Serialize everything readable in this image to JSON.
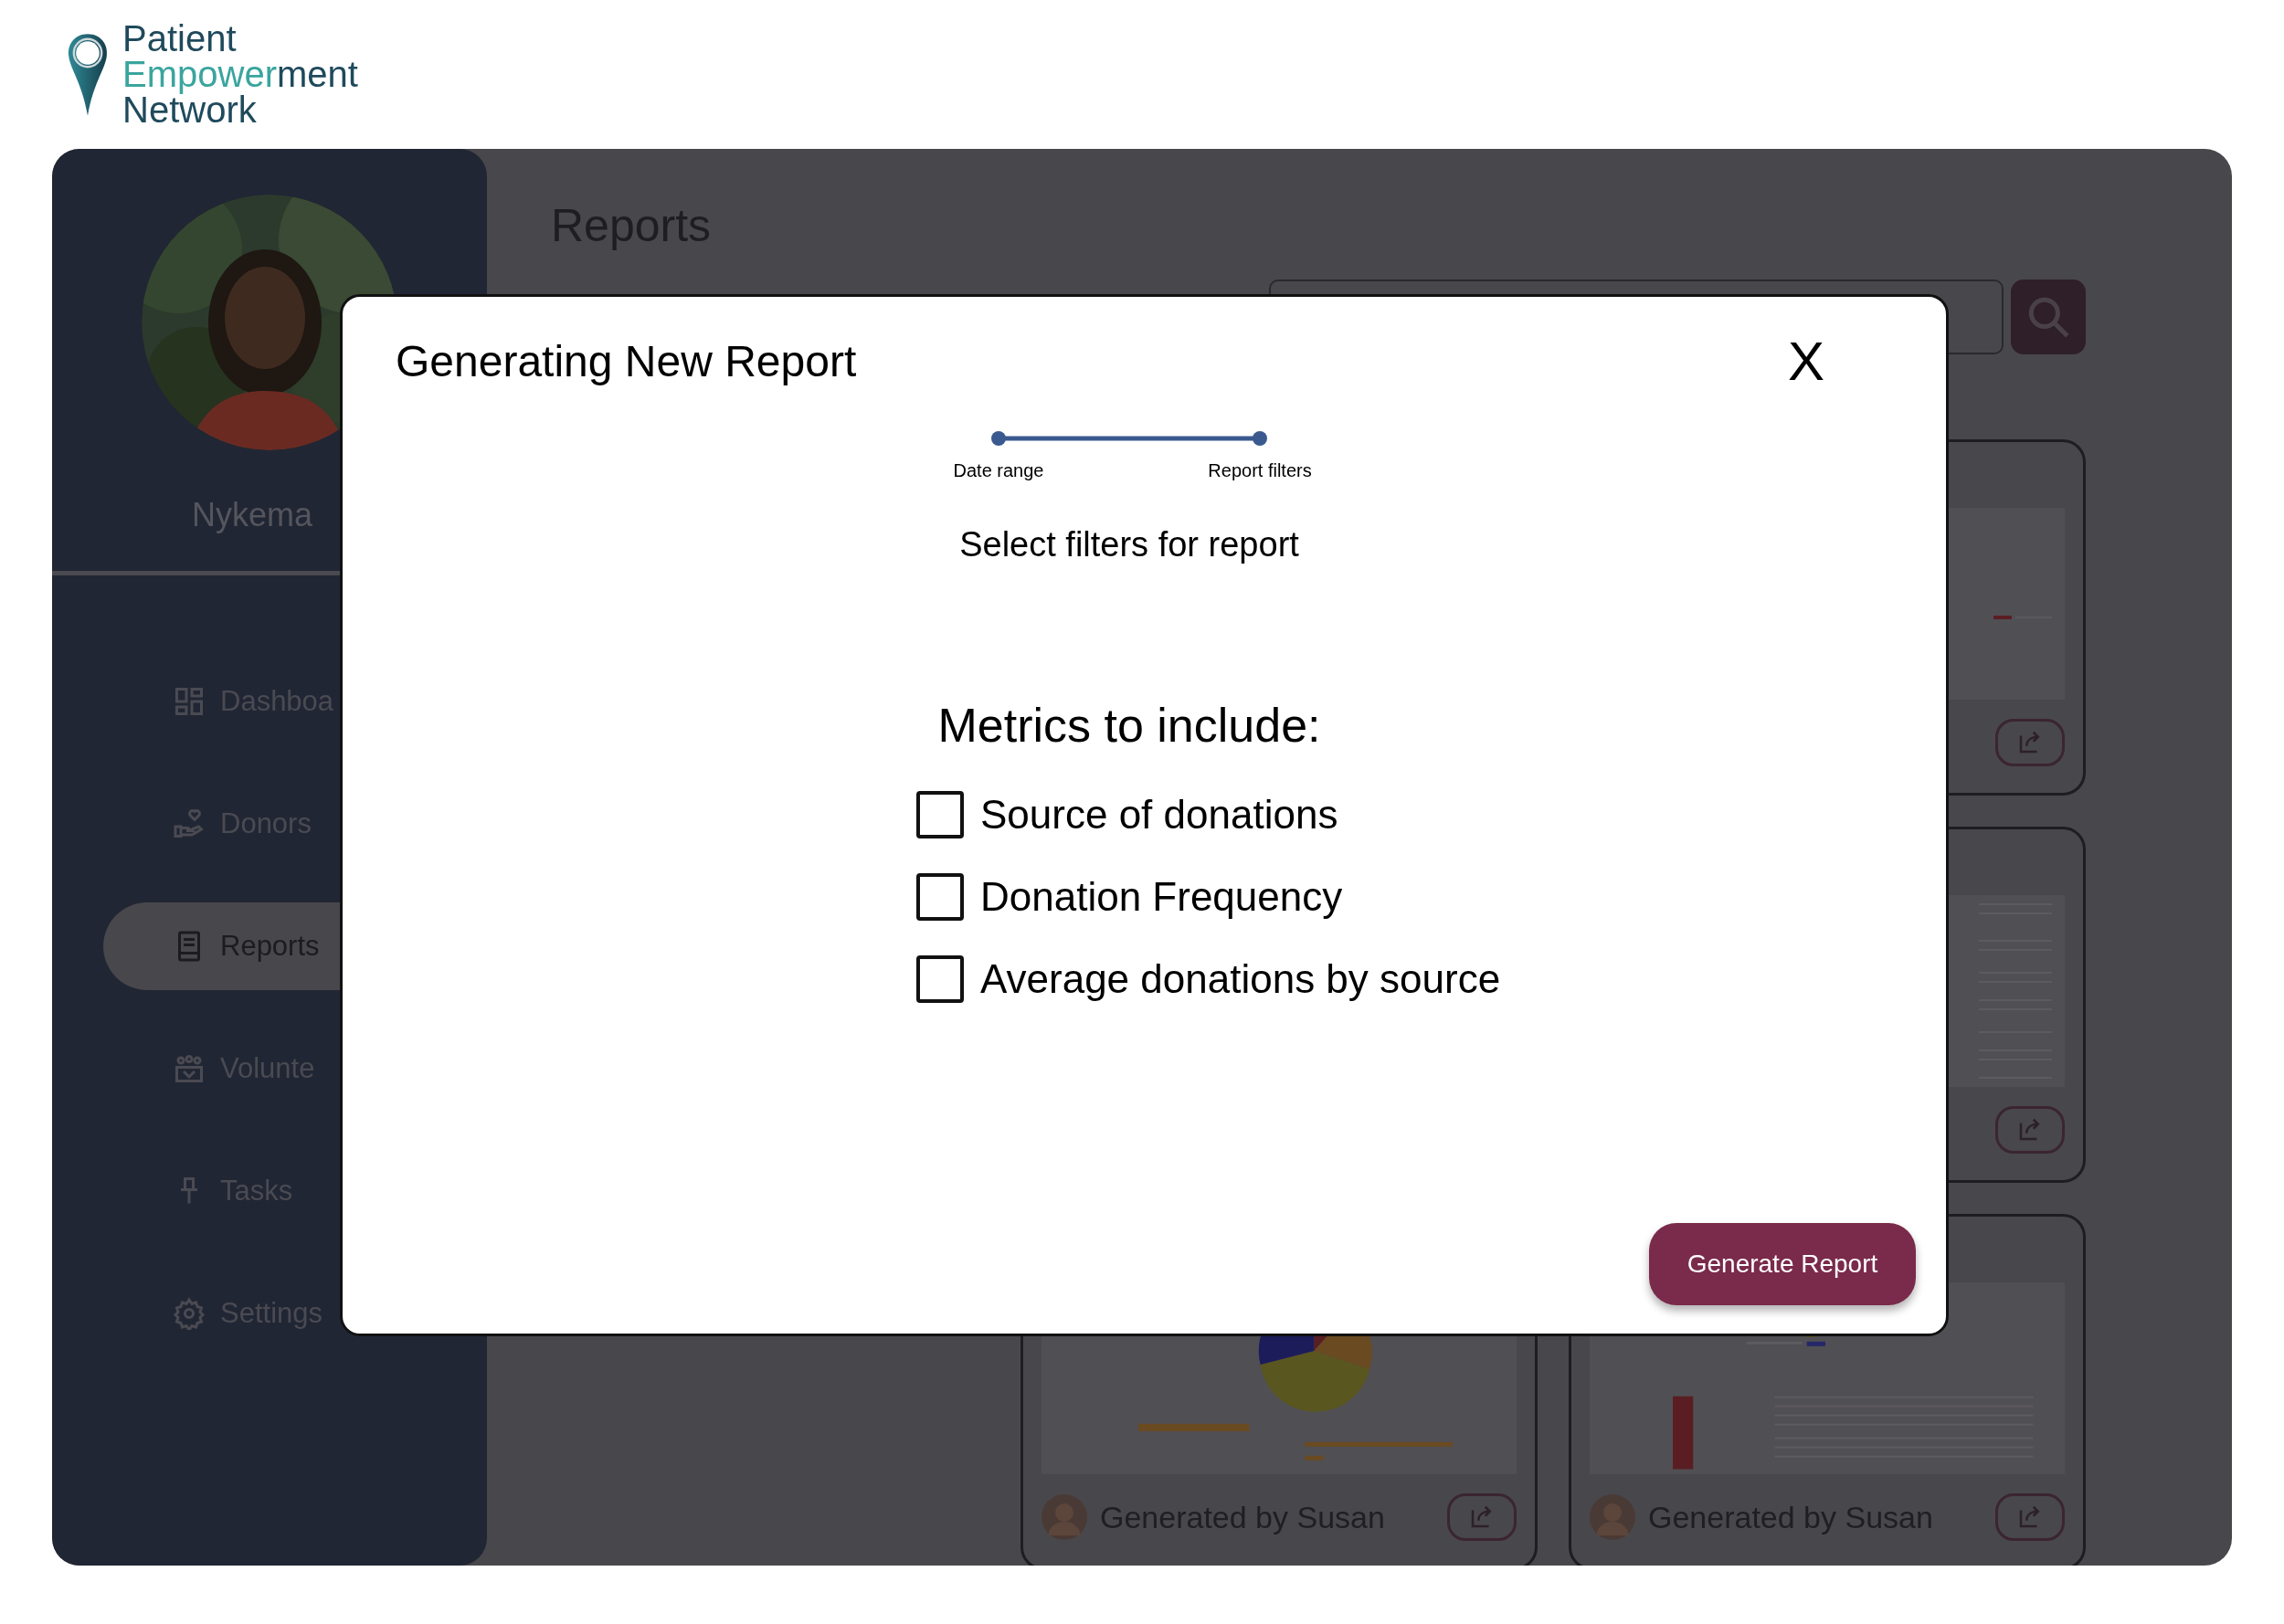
{
  "logo": {
    "lines": [
      [
        {
          "text": "Patient",
          "accent": false
        }
      ],
      [
        {
          "text": "Empower",
          "accent": true
        },
        {
          "text": "ment",
          "accent": false
        }
      ],
      [
        {
          "text": "Network",
          "accent": false
        }
      ]
    ]
  },
  "sidebar": {
    "user_name": "Nykema",
    "items": [
      {
        "kind": "dashboard",
        "label": "Dashboa",
        "selected": false
      },
      {
        "kind": "donors",
        "label": "Donors",
        "selected": false
      },
      {
        "kind": "reports",
        "label": "Reports",
        "selected": true
      },
      {
        "kind": "volunteers",
        "label": "Volunte",
        "selected": false
      },
      {
        "kind": "tasks",
        "label": "Tasks",
        "selected": false
      },
      {
        "kind": "settings",
        "label": "Settings",
        "selected": false
      }
    ]
  },
  "main": {
    "title": "Reports",
    "cards": [
      {
        "kind": "bars"
      },
      {
        "kind": "text"
      },
      {
        "kind": "pie",
        "author": "Generated by Susan"
      },
      {
        "kind": "table",
        "author": "Generated by Susan"
      }
    ]
  },
  "dialog": {
    "title": "Generating New Report",
    "close": "X",
    "steps": [
      {
        "label": "Date range"
      },
      {
        "label": "Report filters"
      }
    ],
    "subtitle": "Select filters for report",
    "metrics_heading": "Metrics to include:",
    "metrics": [
      {
        "label": "Source of donations",
        "checked": false
      },
      {
        "label": "Donation Frequency",
        "checked": false
      },
      {
        "label": "Average donations by source",
        "checked": false
      }
    ],
    "generate_button": "Generate Report"
  }
}
